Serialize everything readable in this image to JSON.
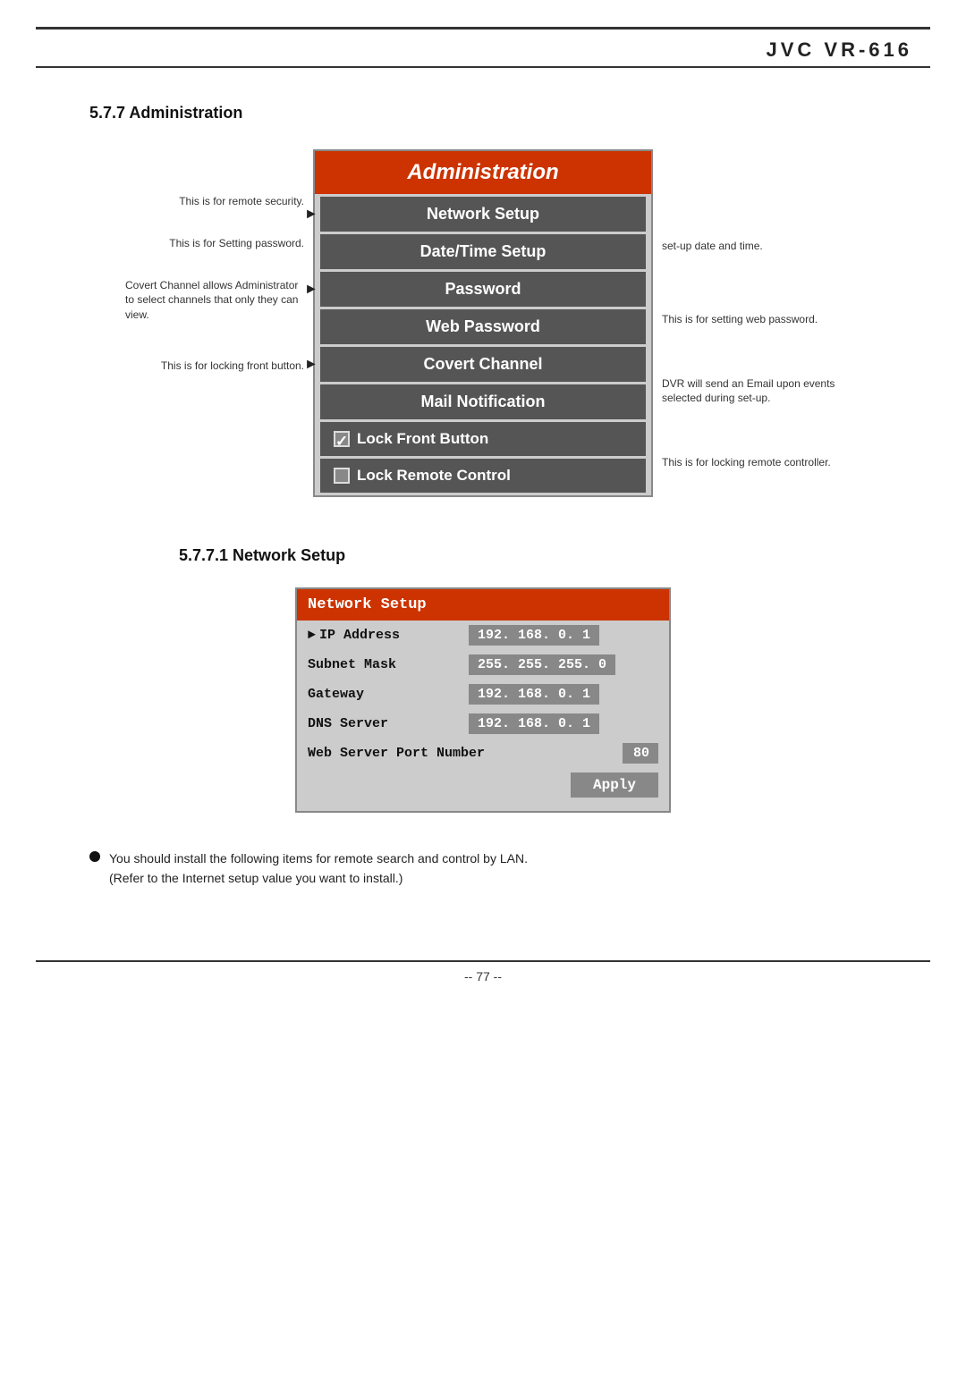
{
  "brand": "JVC VR-616",
  "section1": {
    "heading": "5.7.7 Administration",
    "admin_title": "Administration",
    "menu_items": [
      {
        "label": "Network Setup",
        "has_arrow": true
      },
      {
        "label": "Date/Time Setup",
        "has_arrow": false
      },
      {
        "label": "Password",
        "has_arrow": true
      },
      {
        "label": "Web Password",
        "has_arrow": false
      },
      {
        "label": "Covert Channel",
        "has_arrow": true
      },
      {
        "label": "Mail Notification",
        "has_arrow": false
      }
    ],
    "checkbox_items": [
      {
        "label": "Lock Front Button",
        "checked": true
      },
      {
        "label": "Lock Remote Control",
        "checked": false
      }
    ],
    "left_annotations": [
      {
        "text": "This is for remote security."
      },
      {
        "text": "This is for Setting password."
      },
      {
        "text": "Covert Channel allows Administrator to select channels that only they can view."
      },
      {
        "text": "This is for locking front button."
      }
    ],
    "right_annotations": [
      {
        "text": "set-up date and time."
      },
      {
        "text": "This is for setting web password."
      },
      {
        "text": "DVR will send an Email upon events selected during set-up."
      },
      {
        "text": "This is for locking remote controller."
      }
    ]
  },
  "section2": {
    "heading": "5.7.7.1  Network Setup",
    "title": "Network Setup",
    "rows": [
      {
        "label": "IP Address",
        "value": "192. 168. 0. 1",
        "arrow": true
      },
      {
        "label": "Subnet Mask",
        "value": "255. 255. 255. 0",
        "arrow": false
      },
      {
        "label": "Gateway",
        "value": "192. 168. 0. 1",
        "arrow": false
      },
      {
        "label": "DNS Server",
        "value": "192. 168. 0. 1",
        "arrow": false
      }
    ],
    "web_server_row": {
      "label": "Web Server Port Number",
      "value": "80"
    },
    "apply_label": "Apply"
  },
  "note": {
    "bullet": "You should install the following items for remote search and control by LAN.",
    "sub_text": "(Refer to the Internet setup value you want to install.)"
  },
  "page_number": "-- 77 --"
}
